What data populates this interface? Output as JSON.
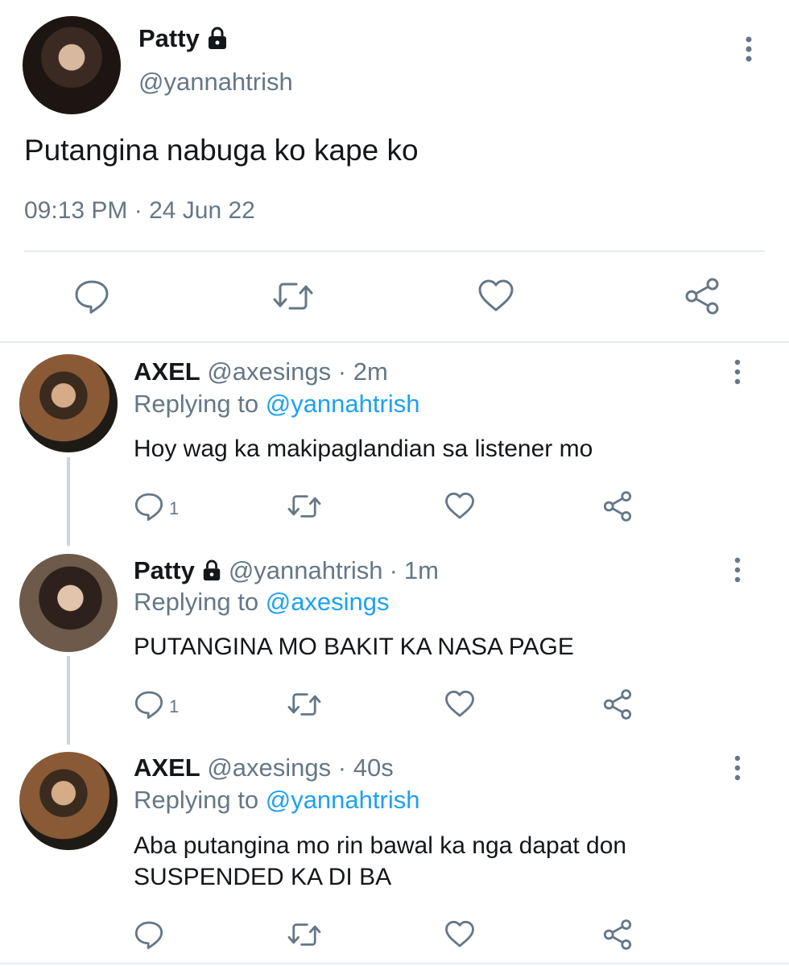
{
  "main_tweet": {
    "author_name": "Patty",
    "author_handle": "@yannahtrish",
    "text": "Putangina nabuga ko kape ko",
    "timestamp": "09:13 PM · 24 Jun 22",
    "icons": [
      "reply-icon",
      "retweet-icon",
      "like-icon",
      "share-icon",
      "lock-icon",
      "more-icon"
    ]
  },
  "replies": [
    {
      "name": "AXEL",
      "handle": "@axesings",
      "time": "2m",
      "replying_prefix": "Replying to",
      "replying_to": "@yannahtrish",
      "text": "Hoy wag ka makipaglandian sa listener mo",
      "reply_count": "1"
    },
    {
      "name": "Patty",
      "handle": "@yannahtrish",
      "time": "1m",
      "replying_prefix": "Replying to",
      "replying_to": "@axesings",
      "text": "PUTANGINA MO BAKIT KA NASA PAGE",
      "reply_count": "1"
    },
    {
      "name": "AXEL",
      "handle": "@axesings",
      "time": "40s",
      "replying_prefix": "Replying to",
      "replying_to": "@yannahtrish",
      "text_line1": "Aba putangina mo rin bawal ka nga dapat don",
      "text_line2": "SUSPENDED KA DI BA",
      "reply_count": ""
    }
  ],
  "separator": "·",
  "colors": {
    "text": "#14171a",
    "secondary": "#657786",
    "link": "#1da1f2",
    "divider": "#e6ecf0"
  }
}
